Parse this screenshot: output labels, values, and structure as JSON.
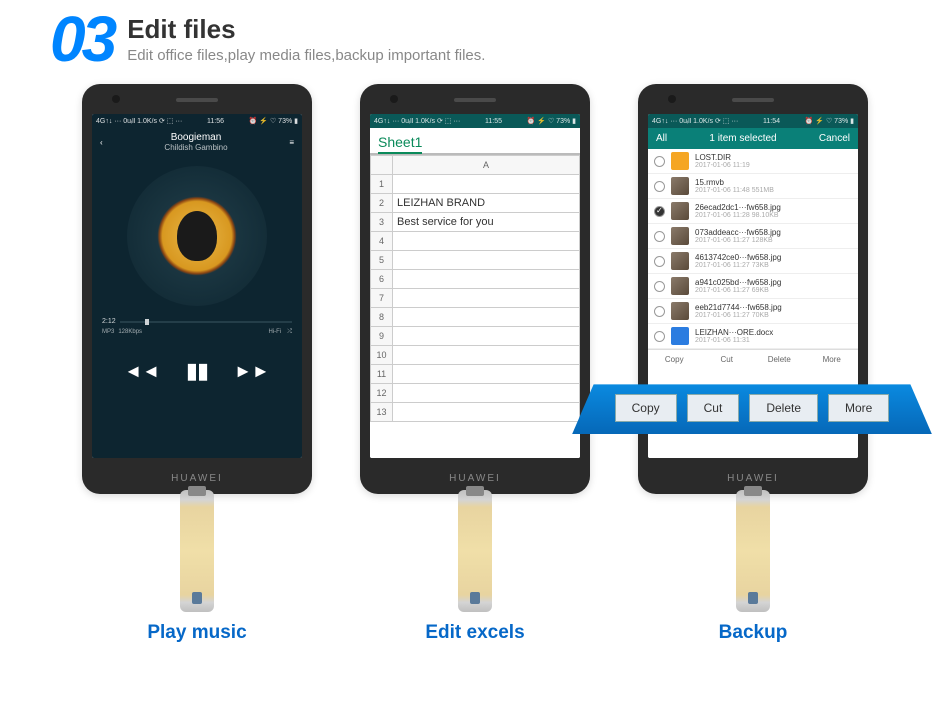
{
  "header": {
    "num": "03",
    "title": "Edit files",
    "subtitle": "Edit office files,play media files,backup important files."
  },
  "status": {
    "left": "4G↑↓ ··· 0uᵢll 1.0K/s ⟳ ⬚ ···",
    "time1": "11:56",
    "time2": "11:55",
    "time3": "11:54",
    "right": "⏰ ⚡ ♡ 73% ▮"
  },
  "music": {
    "song": "Boogieman",
    "artist": "Childish Gambino",
    "pos": "2:12",
    "meta1": "MP3",
    "meta2": "128Kbps",
    "hifi": "Hi-Fi",
    "shuffle": "⤮"
  },
  "excel": {
    "tab": "Sheet1",
    "col": "A",
    "rows": [
      "",
      "LEIZHAN BRAND",
      "Best service for you",
      "",
      "",
      "",
      "",
      "",
      "",
      "",
      "",
      "",
      ""
    ]
  },
  "backup": {
    "all": "All",
    "title": "1 item selected",
    "cancel": "Cancel",
    "files": [
      {
        "name": "LOST.DIR",
        "meta": "2017-01-06 11:19",
        "folder": true
      },
      {
        "name": "15.rmvb",
        "meta": "2017-01-06 11:48 551MB"
      },
      {
        "name": "26ecad2dc1···fw658.jpg",
        "meta": "2017-01-06 11:28 98.10KB",
        "chk": true
      },
      {
        "name": "073addeacc···fw658.jpg",
        "meta": "2017-01-06 11:27 128KB"
      },
      {
        "name": "4613742ce0···fw658.jpg",
        "meta": "2017-01-06 11:27 73KB"
      },
      {
        "name": "a941c025bd···fw658.jpg",
        "meta": "2017-01-06 11:27 69KB"
      },
      {
        "name": "eeb21d7744···fw658.jpg",
        "meta": "2017-01-06 11:27 70KB"
      },
      {
        "name": "LEIZHAN···ORE.docx",
        "meta": "2017-01-06 11:31",
        "doc": true
      }
    ],
    "tools": [
      "Copy",
      "Cut",
      "Delete",
      "More"
    ]
  },
  "float": [
    "Copy",
    "Cut",
    "Delete",
    "More"
  ],
  "captions": [
    "Play music",
    "Edit excels",
    "Backup"
  ]
}
